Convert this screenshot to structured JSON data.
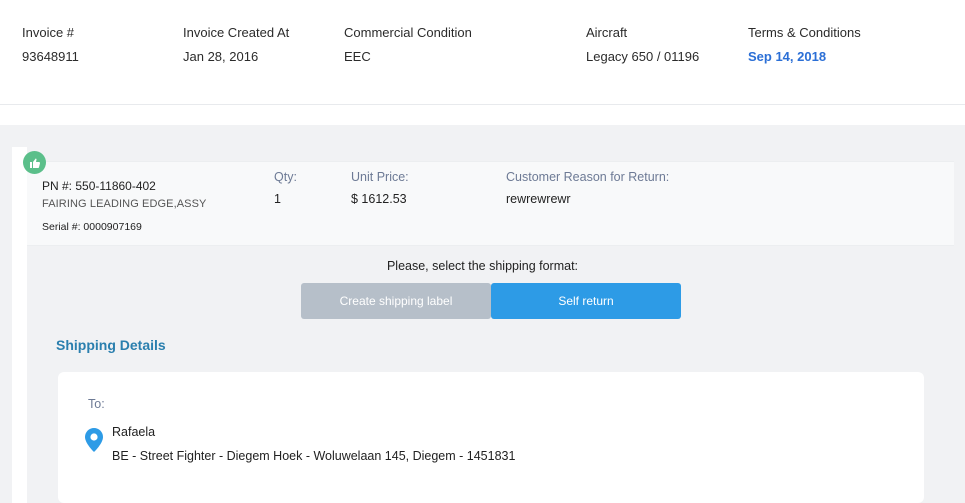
{
  "header": {
    "invoice": {
      "label": "Invoice #",
      "value": "93648911"
    },
    "created": {
      "label": "Invoice Created At",
      "value": "Jan 28, 2016"
    },
    "condition": {
      "label": "Commercial Condition",
      "value": "EEC"
    },
    "aircraft": {
      "label": "Aircraft",
      "value": "Legacy 650 / 01196"
    },
    "terms": {
      "label": "Terms & Conditions",
      "value": "Sep 14, 2018"
    }
  },
  "item": {
    "pn": "PN #: 550-11860-402",
    "description": "FAIRING LEADING EDGE,ASSY",
    "serial": "Serial #: 0000907169",
    "qty_label": "Qty:",
    "qty_value": "1",
    "price_label": "Unit Price:",
    "price_value": "$ 1612.53",
    "reason_label": "Customer Reason for Return:",
    "reason_value": "rewrewrewr"
  },
  "shipping": {
    "prompt": "Please, select the shipping format:",
    "create_label": "Create shipping label",
    "self_return": "Self return",
    "details_title": "Shipping Details",
    "to_label": "To:",
    "name": "Rafaela",
    "address": "BE - Street Fighter - Diegem Hoek - Woluwelaan 145, Diegem - 1451831"
  },
  "colors": {
    "accent_blue": "#2d9be6",
    "link_blue": "#2b6fd6",
    "badge_green": "#5bbf8a",
    "title_blue": "#2a7fae"
  },
  "icons": [
    "thumbs-up-icon",
    "map-pin-icon"
  ]
}
